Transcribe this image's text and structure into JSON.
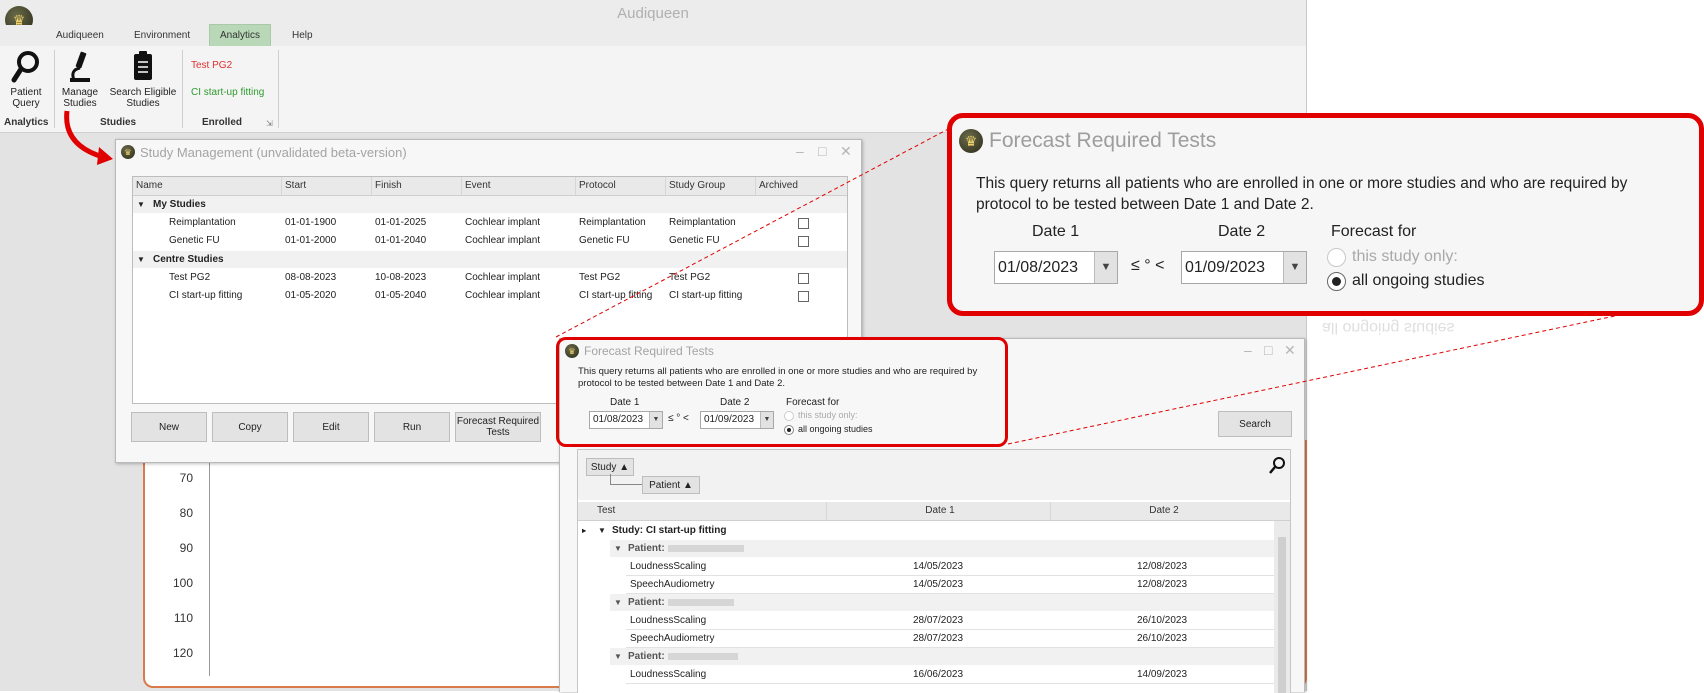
{
  "app": {
    "title": "Audiqueen",
    "menu": [
      "Audiqueen",
      "Environment",
      "Analytics",
      "Help"
    ],
    "active_menu": "Analytics"
  },
  "ribbon": {
    "patient_query": "Patient\nQuery",
    "manage_studies": "Manage\nStudies",
    "search_eligible": "Search Eligible\nStudies",
    "enrolled_items": [
      "Test PG2",
      "CI start-up fitting"
    ],
    "groups": {
      "analytics": "Analytics",
      "studies": "Studies",
      "enrolled": "Enrolled"
    }
  },
  "study_management": {
    "title": "Study Management (unvalidated beta-version)",
    "columns": [
      "Name",
      "Start",
      "Finish",
      "Event",
      "Protocol",
      "Study Group",
      "Archived"
    ],
    "groups": [
      {
        "label": "My Studies",
        "rows": [
          [
            "Reimplantation",
            "01-01-1900",
            "01-01-2025",
            "Cochlear implant",
            "Reimplantation",
            "Reimplantation"
          ],
          [
            "Genetic FU",
            "01-01-2000",
            "01-01-2040",
            "Cochlear implant",
            "Genetic FU",
            "Genetic FU"
          ]
        ]
      },
      {
        "label": "Centre Studies",
        "rows": [
          [
            "Test PG2",
            "08-08-2023",
            "10-08-2023",
            "Cochlear implant",
            "Test PG2",
            "Test PG2"
          ],
          [
            "CI start-up fitting",
            "01-05-2020",
            "01-05-2040",
            "Cochlear implant",
            "CI start-up fitting",
            "CI start-up fitting"
          ]
        ]
      }
    ],
    "buttons": [
      "New",
      "Copy",
      "Edit",
      "Run",
      "Forecast Required\nTests"
    ]
  },
  "chart_bg": {
    "yticks": [
      "70",
      "80",
      "90",
      "100",
      "110",
      "120"
    ]
  },
  "forecast": {
    "title": "Forecast Required Tests",
    "description": "This query returns all patients who are enrolled in one or more studies and who are required by protocol to be tested between Date 1 and Date 2.",
    "date1_label": "Date 1",
    "date2_label": "Date 2",
    "date1": "01/08/2023",
    "date2": "01/09/2023",
    "between_symbol": "≤ ° <",
    "forecast_for_label": "Forecast for",
    "options": [
      "this study only:",
      "all ongoing studies"
    ],
    "selected_option": "all ongoing studies",
    "search_button": "Search",
    "group_chips": [
      "Study",
      "Patient"
    ],
    "columns": [
      "Test",
      "Date 1",
      "Date 2"
    ],
    "study_label": "Study: CI start-up fitting",
    "patient_label": "Patient:",
    "patients": [
      {
        "tests": [
          [
            "LoudnessScaling",
            "14/05/2023",
            "12/08/2023"
          ],
          [
            "SpeechAudiometry",
            "14/05/2023",
            "12/08/2023"
          ]
        ]
      },
      {
        "tests": [
          [
            "LoudnessScaling",
            "28/07/2023",
            "26/10/2023"
          ],
          [
            "SpeechAudiometry",
            "28/07/2023",
            "26/10/2023"
          ]
        ]
      },
      {
        "tests": [
          [
            "LoudnessScaling",
            "16/06/2023",
            "14/09/2023"
          ]
        ]
      }
    ]
  },
  "colors": {
    "highlight": "#e00000",
    "active_tab": "#b8d8b8",
    "test_pg2": "#e03030",
    "ci_startup": "#2e9a2e"
  }
}
